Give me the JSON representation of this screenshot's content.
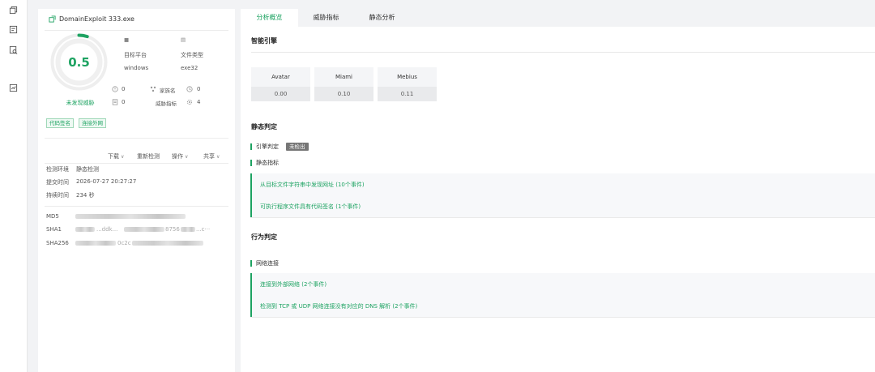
{
  "rail": {
    "icons": [
      "copy-icon",
      "list-check-icon",
      "search-doc-icon",
      "chart-icon"
    ]
  },
  "file": {
    "name": "DomainExploit 333.exe",
    "score": "0.5",
    "score_fraction": 0.05,
    "verdict": "未发现威胁",
    "platform_icon_label": "■",
    "platform_label": "目标平台",
    "platform_value": "windows",
    "filetype_icon_label": "▤",
    "filetype_label": "文件类型",
    "filetype_value": "exe32",
    "stats": [
      {
        "icon": "warning-icon",
        "value": "0"
      },
      {
        "icon": "cluster-icon",
        "label": "家族名",
        "value": "0"
      },
      {
        "icon": "clock-icon",
        "value": "0"
      },
      {
        "icon": "doc-icon",
        "value": "0"
      },
      {
        "icon": "threat-icon",
        "label": "威胁指标",
        "value": "0"
      },
      {
        "icon": "gear-icon",
        "value": "4"
      }
    ],
    "tags": [
      "代码签名",
      "连接外网"
    ]
  },
  "actions": {
    "download": "下载",
    "recheck": "重新检测",
    "operate": "操作",
    "share": "共享"
  },
  "info": {
    "env_label": "检测环境",
    "env_value": "静态检测",
    "submit_label": "提交时间",
    "submit_value": "2026-07-27 20:27:27",
    "duration_label": "持续时间",
    "duration_value": "234 秒"
  },
  "hashes": {
    "md5_label": "MD5",
    "sha1_label": "SHA1",
    "sha1_partial_a": "...ddk...",
    "sha1_partial_b": "8756",
    "sha1_partial_c": "...c···",
    "sha256_label": "SHA256",
    "sha256_partial": "0c2c"
  },
  "tabs": [
    "分析概览",
    "威胁指标",
    "静态分析"
  ],
  "active_tab": 0,
  "engine_section": {
    "title": "智能引擎",
    "engines": [
      {
        "name": "Avatar",
        "value": "0.00"
      },
      {
        "name": "Miami",
        "value": "0.10"
      },
      {
        "name": "Mebius",
        "value": "0.11"
      }
    ]
  },
  "static_section": {
    "title": "静态判定",
    "engine_verdict_label": "引擎判定",
    "engine_verdict_badge": "未检出",
    "indicator_label": "静态指标",
    "events": [
      "从目标文件字符串中发现网址 (10个事件)",
      "可执行程序文件具有代码签名 (1个事件)"
    ]
  },
  "behavior_section": {
    "title": "行为判定",
    "network_label": "网络连接",
    "events": [
      "连接到外部网络 (2个事件)",
      "检测到 TCP 或 UDP 网络连接没有对应的 DNS 解析 (2个事件)"
    ]
  },
  "colors": {
    "accent": "#1ea362",
    "background": "#f2f3f5",
    "badge": "#767676"
  }
}
